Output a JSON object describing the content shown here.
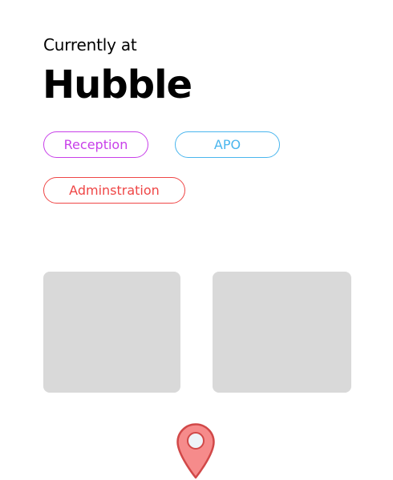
{
  "header": {
    "subtitle": "Currently at",
    "title": "Hubble"
  },
  "tags": [
    {
      "label": "Reception",
      "color": "#c840e9"
    },
    {
      "label": "APO",
      "color": "#4ab6ee"
    },
    {
      "label": "Adminstration",
      "color": "#ef4646"
    }
  ],
  "cards": [
    {
      "color": "#d9d9d9"
    },
    {
      "color": "#d9d9d9"
    }
  ],
  "location_pin": {
    "icon": "map-pin-icon",
    "fill": "#f68b8b",
    "stroke": "#d14848",
    "center": "#eef3f8"
  }
}
